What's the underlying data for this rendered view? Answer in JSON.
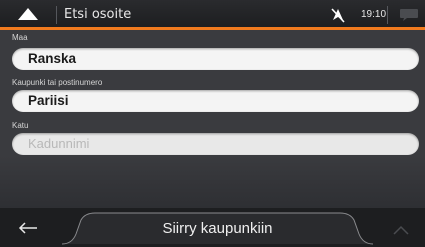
{
  "header": {
    "title": "Etsi osoite",
    "time": "19:10",
    "accent_color": "#f07a1e",
    "icons": [
      "navigation-arrow-icon",
      "gps-off-icon",
      "message-icon"
    ]
  },
  "fields": [
    {
      "label": "Maa",
      "value": "Ranska"
    },
    {
      "label": "Kaupunki tai postinumero",
      "value": "Pariisi"
    },
    {
      "label": "Katu",
      "value": "",
      "placeholder": "Kadunnimi"
    }
  ],
  "bottom_bar": {
    "action_label": "Siirry kaupunkiin",
    "icons": [
      "back-arrow-icon",
      "up-arrow-icon"
    ]
  }
}
